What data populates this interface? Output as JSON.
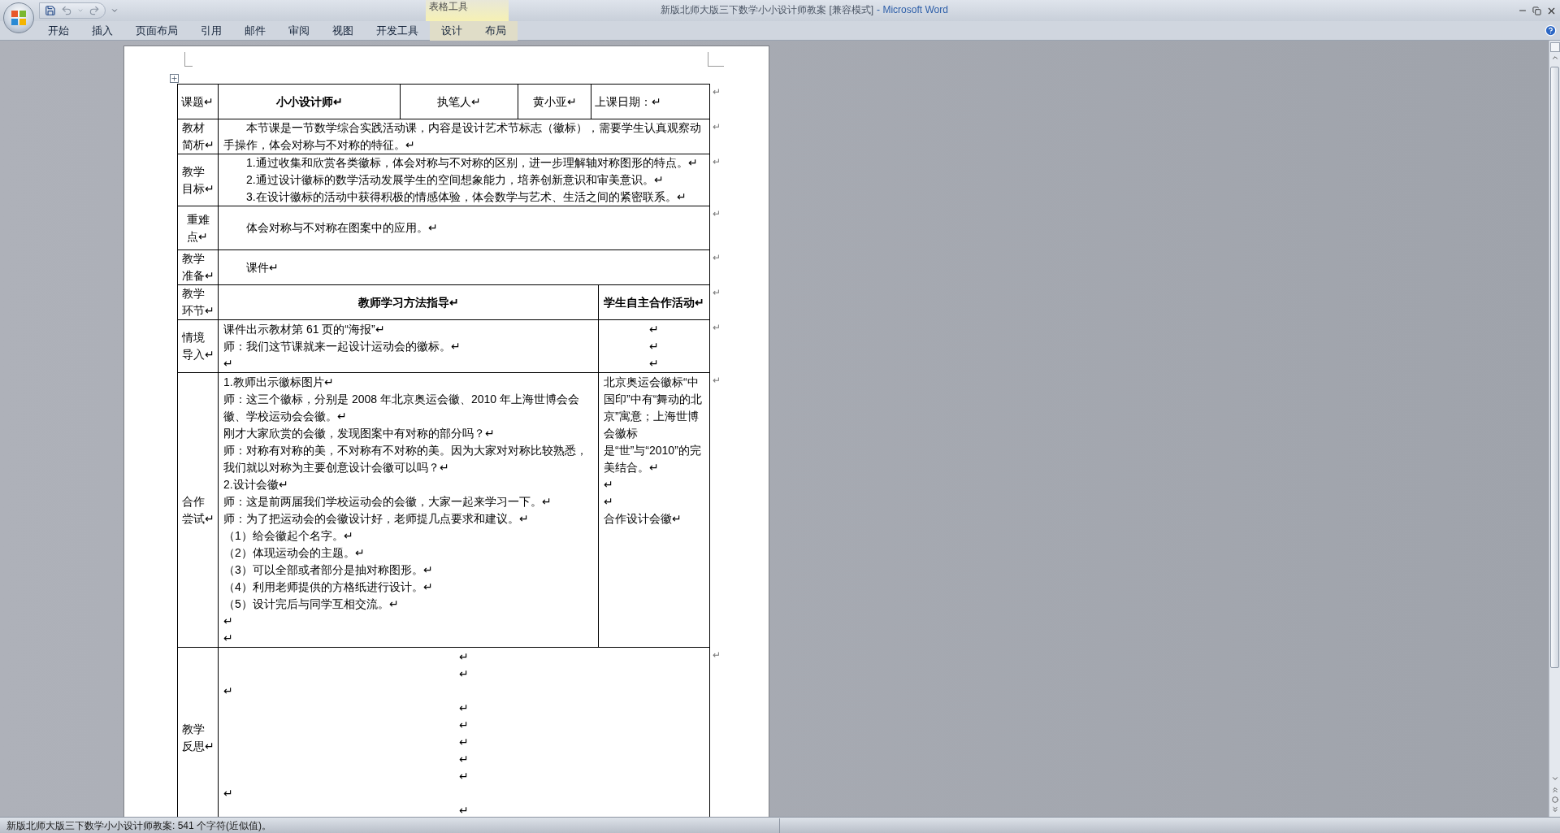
{
  "window": {
    "title_document": "新版北师大版三下数学小小设计师教案 [兼容模式]",
    "title_app": "- Microsoft Word",
    "contextual_group": "表格工具"
  },
  "ribbon_tabs": [
    {
      "label": "开始",
      "contextual": false
    },
    {
      "label": "插入",
      "contextual": false
    },
    {
      "label": "页面布局",
      "contextual": false
    },
    {
      "label": "引用",
      "contextual": false
    },
    {
      "label": "邮件",
      "contextual": false
    },
    {
      "label": "审阅",
      "contextual": false
    },
    {
      "label": "视图",
      "contextual": false
    },
    {
      "label": "开发工具",
      "contextual": false
    },
    {
      "label": "设计",
      "contextual": true
    },
    {
      "label": "布局",
      "contextual": true
    }
  ],
  "table": {
    "header": {
      "cells": [
        {
          "text": "课题↵",
          "bold": false
        },
        {
          "text": "小小设计师↵",
          "bold": true
        },
        {
          "text": "执笔人↵",
          "bold": false
        },
        {
          "text": "黄小亚↵",
          "bold": false
        },
        {
          "text": "上课日期：↵",
          "bold": false
        }
      ],
      "end_mark": "↵"
    },
    "rows": [
      {
        "kind": "span",
        "label": [
          "教材",
          "简析↵"
        ],
        "end_mark": "↵",
        "cells": [
          {
            "paragraphs": [
              {
                "text": "本节课是一节数学综合实践活动课，内容是设计艺术节标志（徽标），需要学生认真观察动手操作，体会对称与不对称的特征。↵",
                "indent": true,
                "centered": false
              }
            ]
          }
        ]
      },
      {
        "kind": "span",
        "label": [
          "教学",
          "目标↵"
        ],
        "end_mark": "↵",
        "cells": [
          {
            "paragraphs": [
              {
                "text": "1.通过收集和欣赏各类徽标，体会对称与不对称的区别，进一步理解轴对称图形的特点。↵",
                "indent": true,
                "centered": false
              },
              {
                "text": "2.通过设计徽标的数学活动发展学生的空间想象能力，培养创新意识和审美意识。↵",
                "indent": true,
                "centered": false
              },
              {
                "text": "3.在设计徽标的活动中获得积极的情感体验，体会数学与艺术、生活之间的紧密联系。↵",
                "indent": true,
                "centered": false
              }
            ]
          }
        ]
      },
      {
        "kind": "span",
        "label": [
          "重难",
          "点↵"
        ],
        "end_mark": "↵",
        "cells": [
          {
            "paragraphs": [
              {
                "text": "体会对称与不对称在图案中的应用。↵",
                "indent": true,
                "centered": false
              }
            ]
          }
        ]
      },
      {
        "kind": "span",
        "label": [
          "教学",
          "准备↵"
        ],
        "end_mark": "↵",
        "cells": [
          {
            "paragraphs": [
              {
                "text": "课件↵",
                "indent": true,
                "centered": false
              }
            ]
          }
        ]
      },
      {
        "kind": "heading",
        "label": [
          "教学",
          "环节↵"
        ],
        "end_mark": "↵",
        "cells": [
          {
            "paragraphs": [
              {
                "text": "教师学习方法指导↵",
                "indent": false
              }
            ]
          },
          {
            "paragraphs": [
              {
                "text": "学生自主合作活动↵",
                "indent": false
              }
            ]
          }
        ]
      },
      {
        "kind": "split",
        "label": [
          "情境",
          "导入↵"
        ],
        "end_mark": "↵",
        "cells": [
          {
            "paragraphs": [
              {
                "text": "课件出示教材第 61 页的“海报”↵",
                "indent": false,
                "centered": false
              },
              {
                "text": "师：我们这节课就来一起设计运动会的徽标。↵",
                "indent": false,
                "centered": false
              },
              {
                "text": "↵",
                "indent": false,
                "centered": false
              }
            ]
          },
          {
            "paragraphs": [
              {
                "text": "↵",
                "indent": false,
                "centered": true
              },
              {
                "text": "↵",
                "indent": false,
                "centered": true
              },
              {
                "text": "↵",
                "indent": false,
                "centered": true
              }
            ]
          }
        ]
      },
      {
        "kind": "split",
        "label": [
          "合作",
          "尝试↵"
        ],
        "end_mark": "↵",
        "cells": [
          {
            "paragraphs": [
              {
                "text": "1.教师出示徽标图片↵",
                "indent": false,
                "centered": false
              },
              {
                "text": "师：这三个徽标，分别是 2008 年北京奥运会徽、2010 年上海世博会会徽、学校运动会会徽。↵",
                "indent": false,
                "centered": false
              },
              {
                "text": "刚才大家欣赏的会徽，发现图案中有对称的部分吗？↵",
                "indent": false,
                "centered": false
              },
              {
                "text": "师：对称有对称的美，不对称有不对称的美。因为大家对对称比较熟悉，我们就以对称为主要创意设计会徽可以吗？↵",
                "indent": false,
                "centered": false
              },
              {
                "text": "2.设计会徽↵",
                "indent": false,
                "centered": false
              },
              {
                "text": "师：这是前两届我们学校运动会的会徽，大家一起来学习一下。↵",
                "indent": false,
                "centered": false
              },
              {
                "text": "师：为了把运动会的会徽设计好，老师提几点要求和建议。↵",
                "indent": false,
                "centered": false
              },
              {
                "text": "（1）给会徽起个名字。↵",
                "indent": false,
                "centered": false
              },
              {
                "text": "（2）体现运动会的主题。↵",
                "indent": false,
                "centered": false
              },
              {
                "text": "（3）可以全部或者部分是抽对称图形。↵",
                "indent": false,
                "centered": false
              },
              {
                "text": "（4）利用老师提供的方格纸进行设计。↵",
                "indent": false,
                "centered": false
              },
              {
                "text": "（5）设计完后与同学互相交流。↵",
                "indent": false,
                "centered": false
              },
              {
                "text": "↵",
                "indent": false,
                "centered": false
              },
              {
                "text": "↵",
                "indent": false,
                "centered": false
              }
            ]
          },
          {
            "paragraphs": [
              {
                "text": "北京奥运会徽标“中国印”中有“舞动的北京”寓意；上海世博会徽标是“世”与“2010”的完美结合。↵",
                "indent": false,
                "centered": false
              },
              {
                "text": "↵",
                "indent": false,
                "centered": false
              },
              {
                "text": "↵",
                "indent": false,
                "centered": false
              },
              {
                "text": "合作设计会徽↵",
                "indent": false,
                "centered": false
              }
            ]
          }
        ]
      },
      {
        "kind": "notes",
        "label": [
          "教学",
          "反思↵"
        ],
        "end_mark": "↵",
        "cells": [
          {
            "paragraphs": [
              {
                "text": "↵",
                "indent": false,
                "centered": true
              },
              {
                "text": "↵",
                "indent": false,
                "centered": true
              },
              {
                "text": "↵",
                "indent": false,
                "centered": false
              },
              {
                "text": "↵",
                "indent": false,
                "centered": true
              },
              {
                "text": "↵",
                "indent": false,
                "centered": true
              },
              {
                "text": "↵",
                "indent": false,
                "centered": true
              },
              {
                "text": "↵",
                "indent": false,
                "centered": true
              },
              {
                "text": "↵",
                "indent": false,
                "centered": true
              },
              {
                "text": "↵",
                "indent": false,
                "centered": false
              },
              {
                "text": "↵",
                "indent": false,
                "centered": true
              }
            ]
          }
        ]
      }
    ]
  },
  "status_bar": {
    "text": "新版北师大版三下数学小小设计师教案: 541 个字符(近似值)。"
  }
}
